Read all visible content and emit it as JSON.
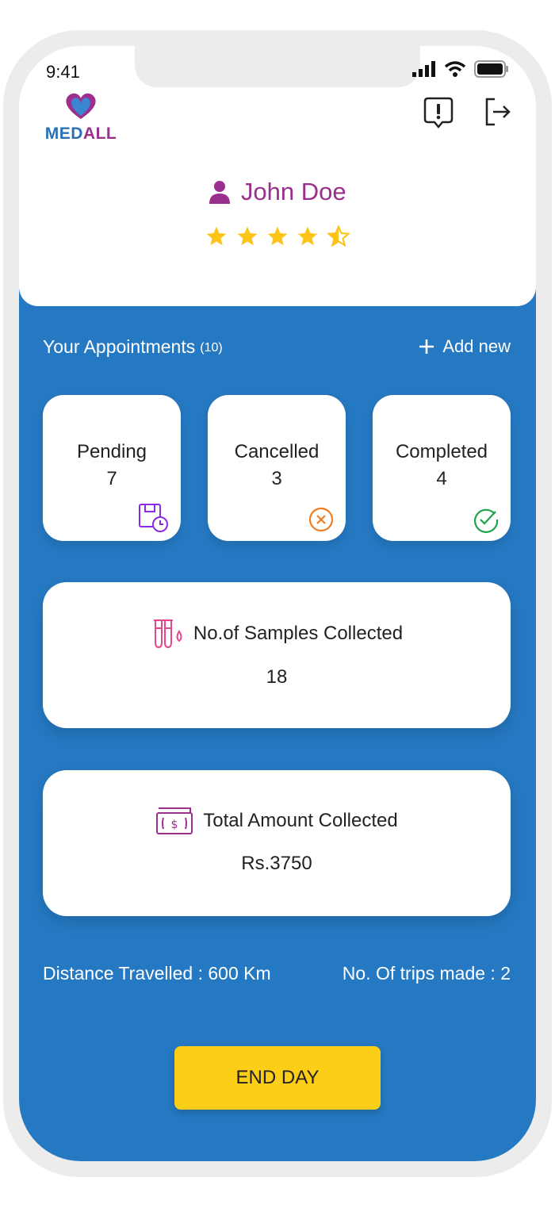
{
  "status_bar": {
    "time": "9:41"
  },
  "brand": {
    "logo_text_main": "MED",
    "logo_text_accent": "ALL"
  },
  "user": {
    "name": "John Doe",
    "rating": 4.5,
    "rating_max": 5
  },
  "appointments": {
    "title": "Your Appointments",
    "count": "(10)",
    "add_label": "Add new"
  },
  "stats": [
    {
      "label": "Pending",
      "value": "7",
      "icon": "calendar-clock-icon"
    },
    {
      "label": "Cancelled",
      "value": "3",
      "icon": "x-circle-icon"
    },
    {
      "label": "Completed",
      "value": "4",
      "icon": "check-circle-icon"
    }
  ],
  "samples": {
    "label": "No.of Samples Collected",
    "value": "18",
    "icon": "test-tubes-icon"
  },
  "amount": {
    "label": "Total Amount Collected",
    "value": "Rs.3750",
    "icon": "cash-icon"
  },
  "footer": {
    "distance": "Distance Travelled : 600 Km",
    "trips": "No. Of trips made : 2"
  },
  "actions": {
    "end_day_label": "END DAY"
  },
  "colors": {
    "brand_purple": "#9b2f8d",
    "brand_blue": "#2579c2",
    "button_yellow": "#fcce18",
    "star": "#fcc419"
  }
}
